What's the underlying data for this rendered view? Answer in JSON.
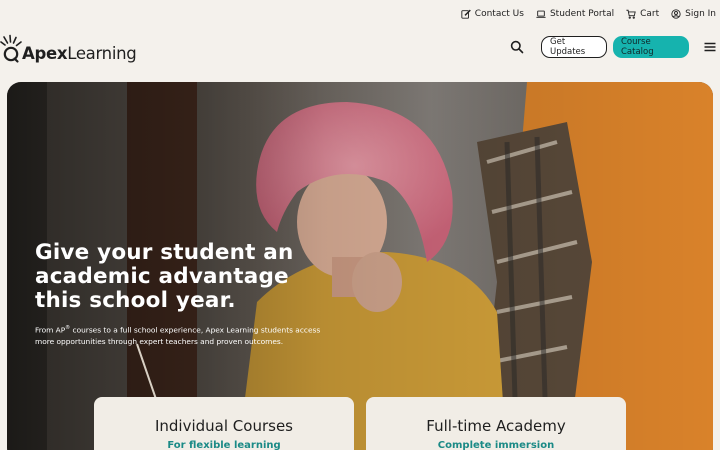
{
  "utility_nav": {
    "contact_label": "Contact Us",
    "portal_label": "Student Portal",
    "cart_label": "Cart",
    "signin_label": "Sign In"
  },
  "brand": {
    "name_bold": "Apex",
    "name_light": "Learning"
  },
  "header": {
    "get_updates_label": "Get Updates",
    "catalog_label": "Course Catalog"
  },
  "hero": {
    "title": "Give your student an academic advantage this school year.",
    "subtitle_pre": "From AP",
    "subtitle_sup": "®",
    "subtitle_post": " courses to a full school experience, Apex Learning students access more opportunities through expert teachers and proven outcomes."
  },
  "cards": [
    {
      "title": "Individual Courses",
      "subtitle": "For flexible learning"
    },
    {
      "title": "Full-time Academy",
      "subtitle": "Complete immersion"
    }
  ],
  "colors": {
    "background": "#f4f1ec",
    "accent": "#16b3ae",
    "accent_text": "#1b8a86"
  },
  "icons": [
    "edit-icon",
    "laptop-icon",
    "cart-icon",
    "user-icon",
    "search-icon",
    "menu-icon"
  ]
}
